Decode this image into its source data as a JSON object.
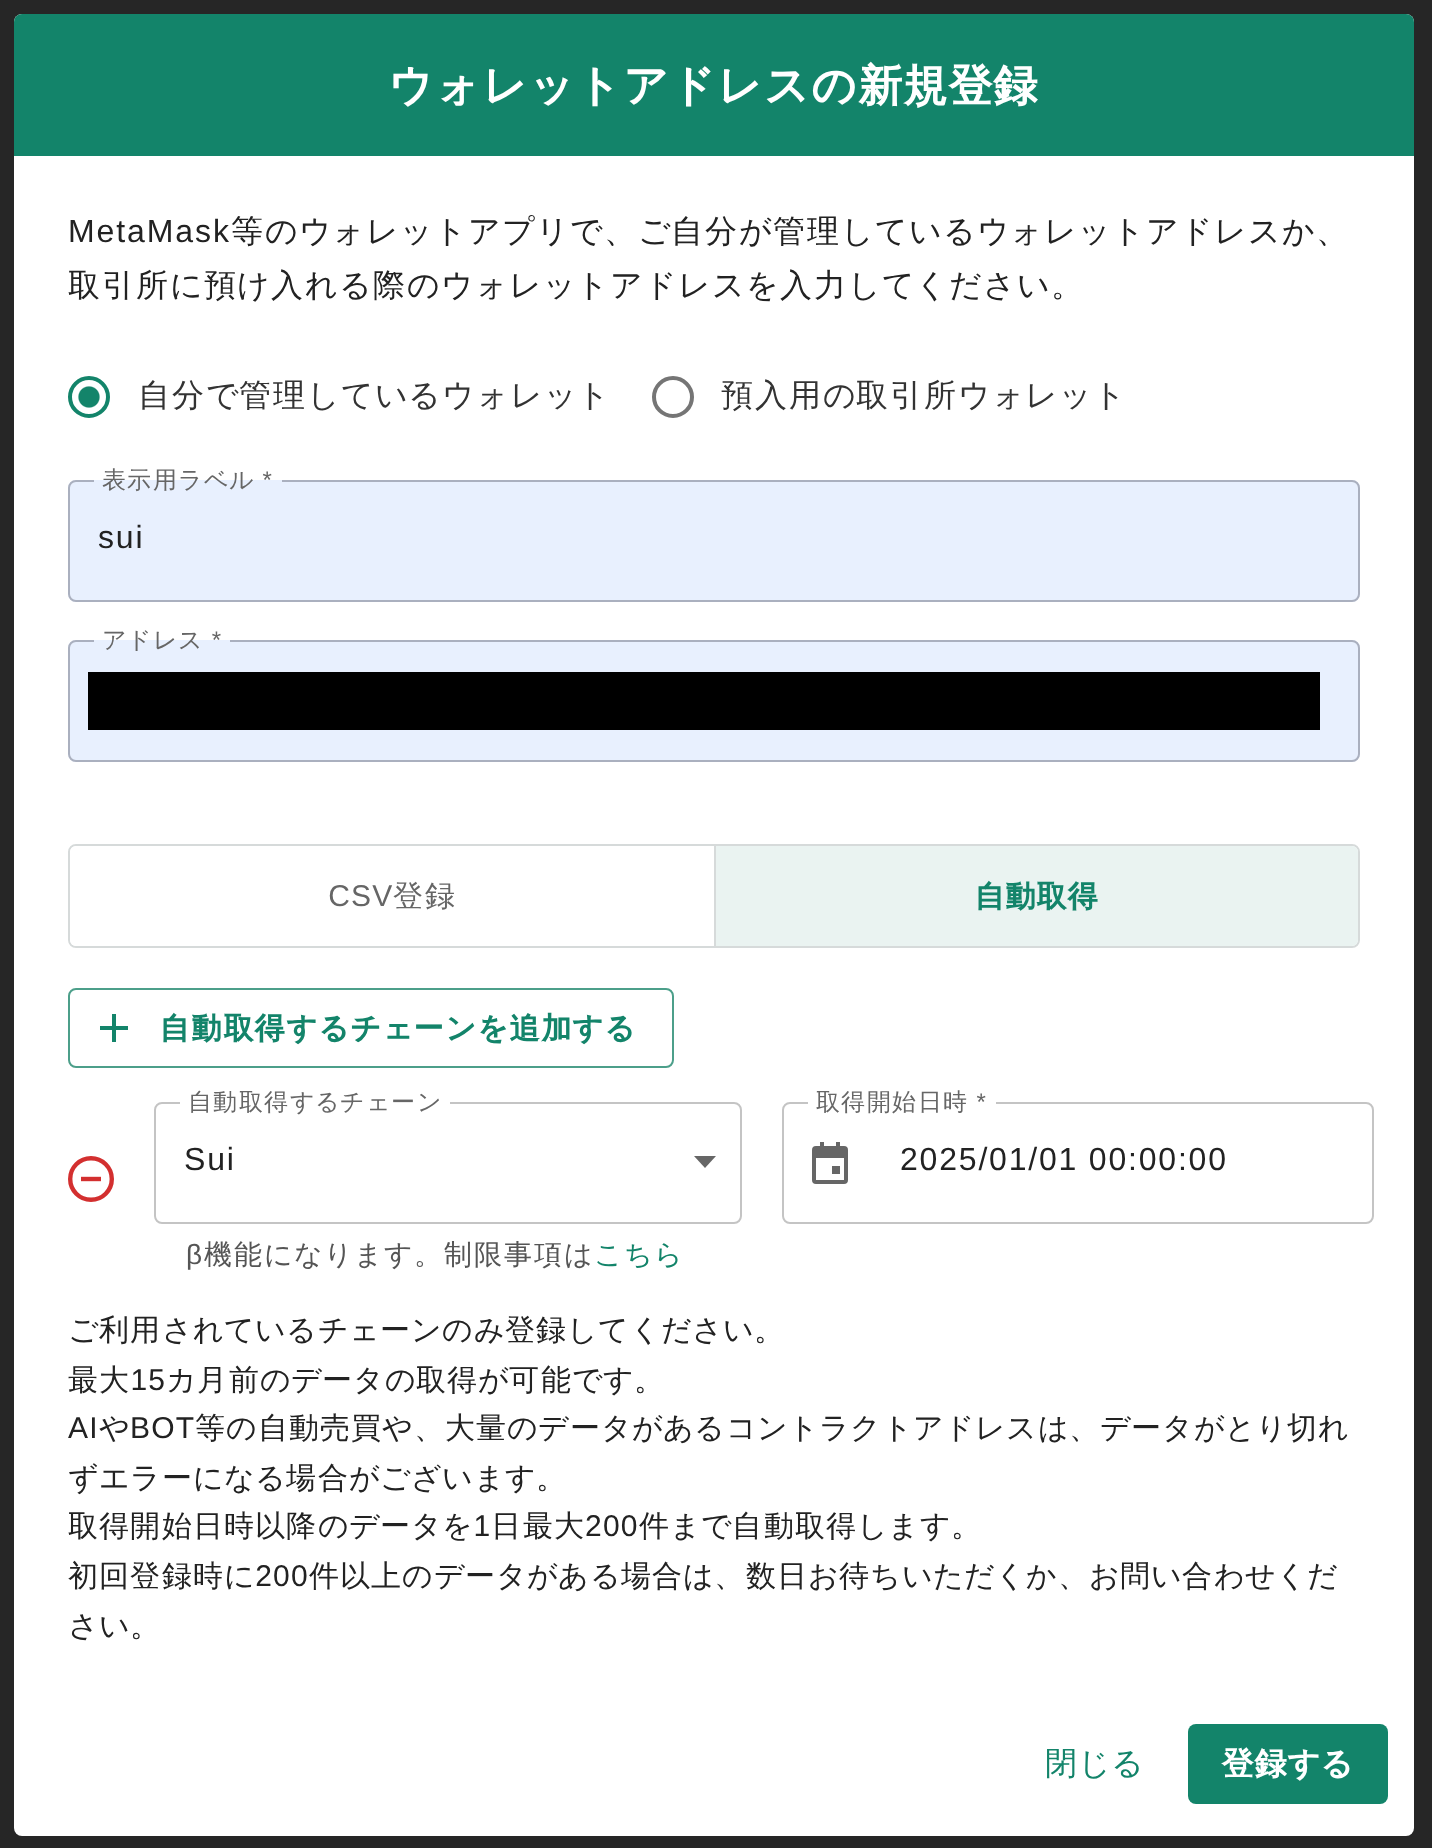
{
  "dialog": {
    "title": "ウォレットアドレスの新規登録",
    "description": "MetaMask等のウォレットアプリで、ご自分が管理しているウォレットアドレスか、取引所に預け入れる際のウォレットアドレスを入力してください。",
    "wallet_type": [
      {
        "label": "自分で管理しているウォレット",
        "selected": true
      },
      {
        "label": "預入用の取引所ウォレット",
        "selected": false
      }
    ],
    "fields": [
      {
        "label": "表示用ラベル *",
        "value": "sui",
        "redacted": false
      },
      {
        "label": "アドレス *",
        "redacted": true
      }
    ],
    "tabs": [
      {
        "label": "CSV登録",
        "selected": false
      },
      {
        "label": "自動取得",
        "selected": true
      }
    ],
    "add_chain_button": {
      "label": "自動取得するチェーンを追加する"
    },
    "chains": [
      {
        "chain_select": {
          "label": "自動取得するチェーン",
          "value": "Sui"
        },
        "start_date": {
          "label": "取得開始日時 *",
          "value": "2025/01/01 00:00:00"
        },
        "helper": "β機能になります。制限事項は",
        "helper_link": "こちら"
      }
    ],
    "notes": [
      "ご利用されているチェーンのみ登録してください。",
      "最大15カ月前のデータの取得が可能です。",
      "AIやBOT等の自動売買や、大量のデータがあるコントラクトアドレスは、データがとり切れずエラーになる場合がございます。",
      "取得開始日時以降のデータを1日最大200件まで自動取得します。",
      "初回登録時に200件以上のデータがある場合は、数日お待ちいただくか、お問い合わせください。"
    ],
    "buttons": [
      {
        "label": "閉じる",
        "kind": "text"
      },
      {
        "label": "登録する",
        "kind": "contained"
      }
    ]
  }
}
